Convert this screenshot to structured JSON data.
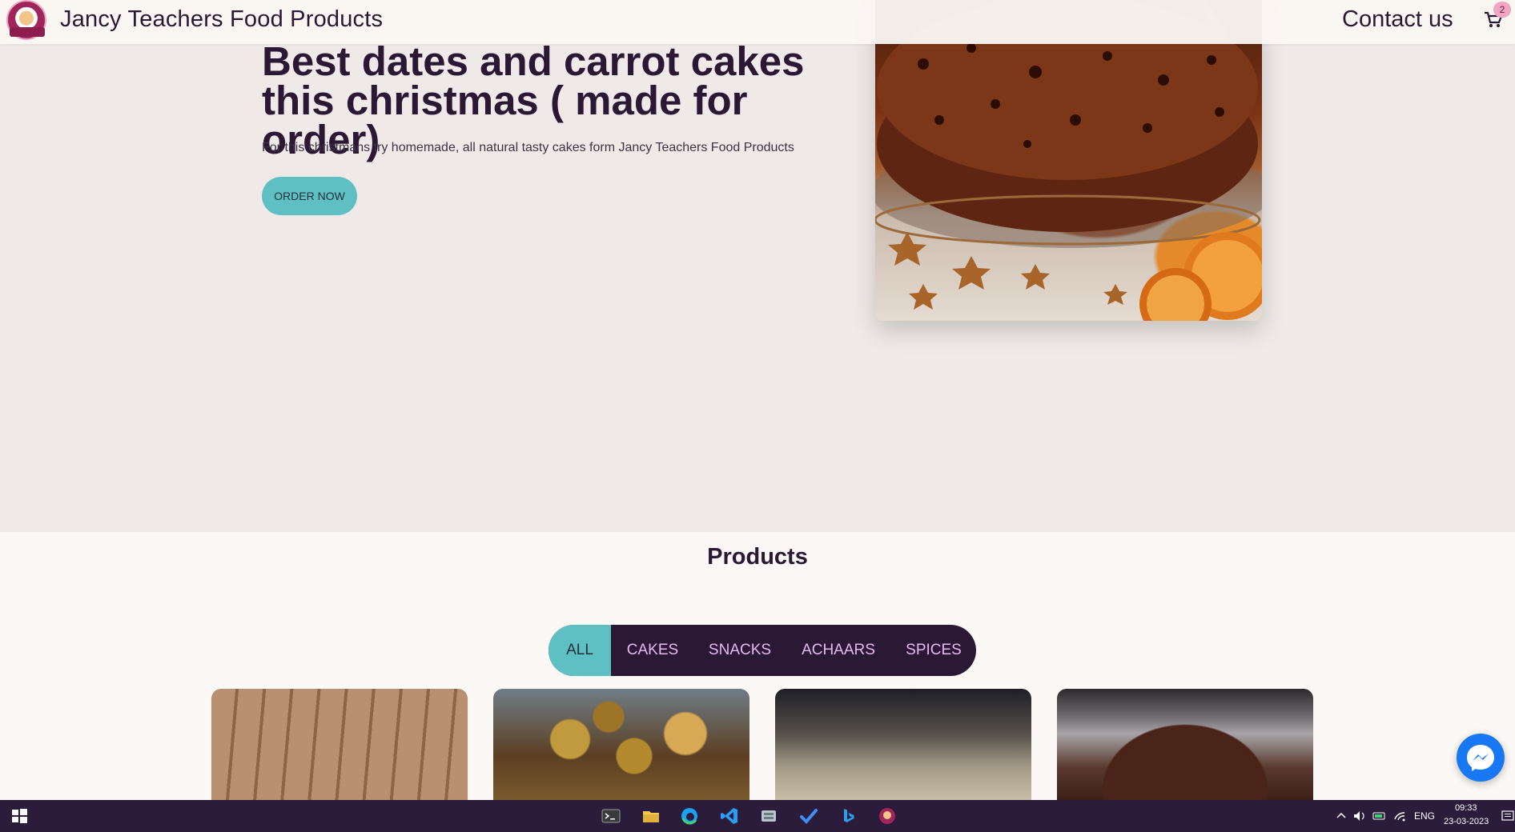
{
  "header": {
    "brand": "Jancy Teachers Food Products",
    "contact": "Contact us",
    "cart_count": "2"
  },
  "hero": {
    "title": "Best dates and carrot cakes this christmas ( made for order)",
    "text": "For this christmans try homemade, all natural tasty cakes form Jancy Teachers Food Products",
    "button": "ORDER NOW"
  },
  "products": {
    "title": "Products",
    "tabs": [
      {
        "label": "ALL",
        "active": true
      },
      {
        "label": "CAKES"
      },
      {
        "label": "SNACKS"
      },
      {
        "label": "ACHAARS"
      },
      {
        "label": "SPICES"
      }
    ]
  },
  "taskbar": {
    "language": "ENG",
    "time": "09:33",
    "date": "23-03-2023"
  },
  "colors": {
    "accent": "#5fc0c3",
    "dark": "#2a1835",
    "tab_text": "#e6b9f0",
    "messenger": "#1877f2"
  }
}
